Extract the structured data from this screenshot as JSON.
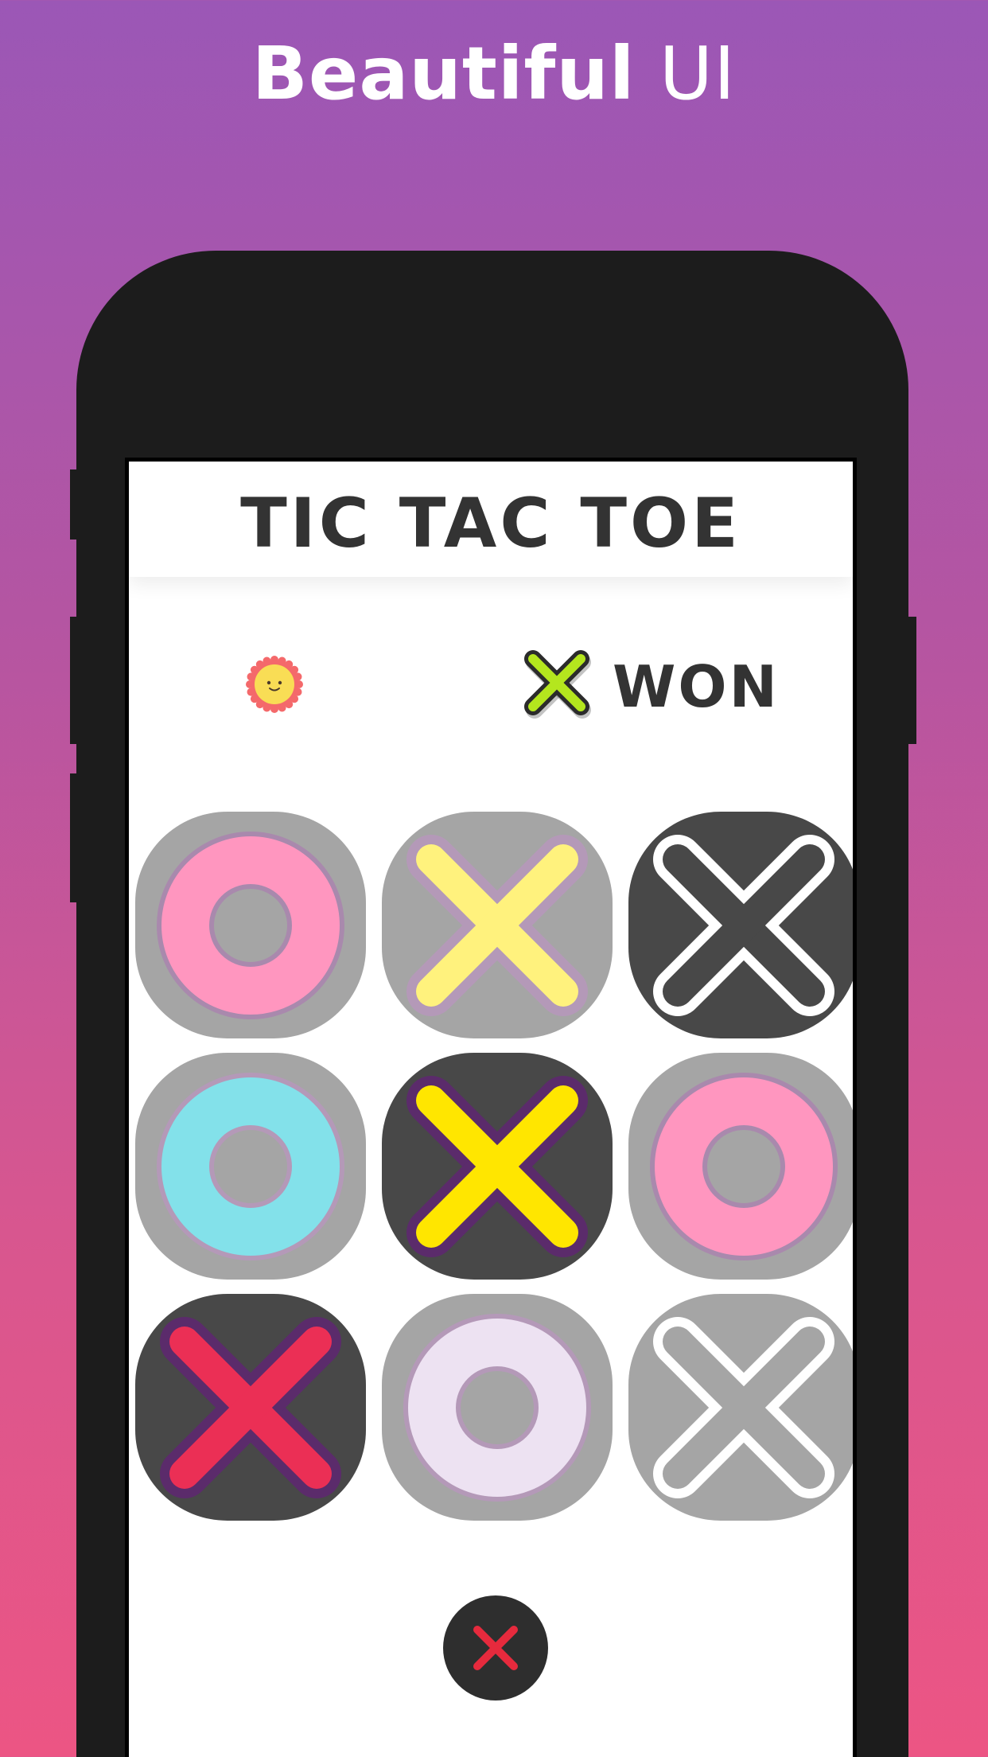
{
  "headline": {
    "bold": "Beautiful",
    "light": "UI"
  },
  "app": {
    "title": "TIC TAC TOE",
    "status": {
      "winner_symbol": "x",
      "label": "WON"
    },
    "board": [
      {
        "mark": "o",
        "state": "dim",
        "ring": "#ff96bf",
        "edge": "#a989ad"
      },
      {
        "mark": "x",
        "state": "dim",
        "stroke": "#fff27d",
        "edge": "#b499b8"
      },
      {
        "mark": "x",
        "state": "dark",
        "stroke": "#484848",
        "edge": "#ffffff"
      },
      {
        "mark": "o",
        "state": "dim",
        "ring": "#83e1ea",
        "edge": "#b499b8"
      },
      {
        "mark": "x",
        "state": "dark",
        "stroke": "#ffe600",
        "edge": "#5b2b6b"
      },
      {
        "mark": "o",
        "state": "dim",
        "ring": "#ff96bf",
        "edge": "#a989ad"
      },
      {
        "mark": "x",
        "state": "dark",
        "stroke": "#eb2f55",
        "edge": "#5b2b6b"
      },
      {
        "mark": "o",
        "state": "dim",
        "ring": "#ede2f2",
        "edge": "#b499b8"
      },
      {
        "mark": "x",
        "state": "dim",
        "stroke": "#a5a5a5",
        "edge": "#ffffff"
      }
    ],
    "reset_icon": "close-icon"
  },
  "colors": {
    "background_top": "#9b57b6",
    "background_bottom": "#ec5584",
    "sun": "#f9dd55",
    "sun_rays": "#f4696b",
    "winner_x": "#b4e61e",
    "reset_x": "#e62a3d"
  }
}
